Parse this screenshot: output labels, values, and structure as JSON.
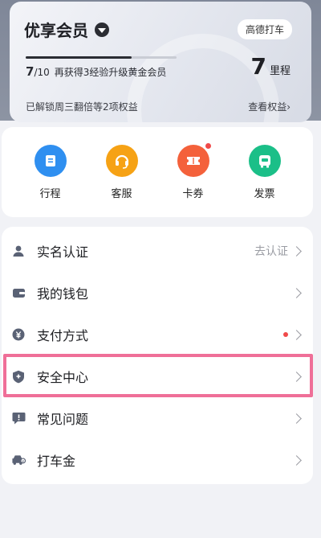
{
  "member": {
    "title": "优享会员",
    "tag": "高德打车",
    "progress_current": "7",
    "progress_total": "/10",
    "progress_desc": "再获得3经验升级黄金会员",
    "progress_fraction": 0.7,
    "points_value": "7",
    "points_unit": "里程",
    "benefits_text": "已解锁周三翻倍等2项权益",
    "view_benefits": "查看权益›"
  },
  "quick": [
    {
      "label": "行程",
      "icon": "itinerary-icon",
      "color": "#2f8ff0"
    },
    {
      "label": "客服",
      "icon": "headset-icon",
      "color": "#f6a215"
    },
    {
      "label": "卡券",
      "icon": "ticket-icon",
      "color": "#f4613b",
      "badge": true
    },
    {
      "label": "发票",
      "icon": "invoice-icon",
      "color": "#1bbf88"
    }
  ],
  "menu": [
    {
      "label": "实名认证",
      "icon": "user-icon",
      "right": "去认证"
    },
    {
      "label": "我的钱包",
      "icon": "wallet-icon",
      "right": ""
    },
    {
      "label": "支付方式",
      "icon": "payment-icon",
      "right": "",
      "dot": true
    },
    {
      "label": "安全中心",
      "icon": "shield-icon",
      "right": ""
    },
    {
      "label": "常见问题",
      "icon": "faq-icon",
      "right": ""
    },
    {
      "label": "打车金",
      "icon": "taxi-fund-icon",
      "right": ""
    }
  ],
  "colors": {
    "highlight": "#ef6f98",
    "icon_gray": "#5a6275"
  }
}
